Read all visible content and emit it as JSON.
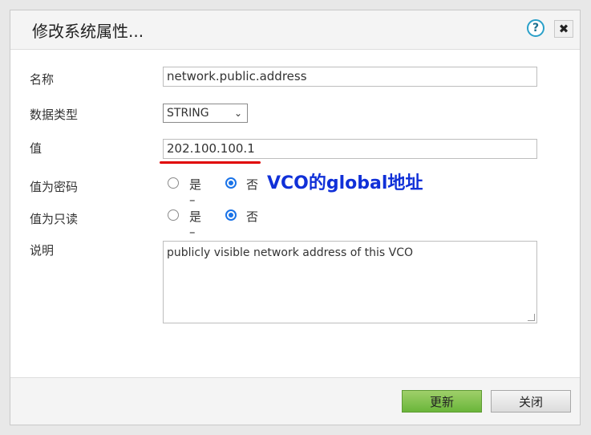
{
  "dialog": {
    "title": "修改系统属性...",
    "help_icon": "?",
    "close_icon": "✖"
  },
  "form": {
    "name_label": "名称",
    "name_value": "network.public.address",
    "type_label": "数据类型",
    "type_value": "STRING",
    "value_label": "值",
    "value_value": "202.100.100.1",
    "password_label": "值为密码",
    "readonly_label": "值为只读",
    "yes_label": "是 –",
    "no_label": "否",
    "description_label": "说明",
    "description_value": "publicly visible network address of this VCO"
  },
  "annotation": {
    "text": "VCO的global地址",
    "text_color": "#1030d8",
    "underline_color": "#e00000"
  },
  "footer": {
    "update_label": "更新",
    "close_label": "关闭"
  }
}
